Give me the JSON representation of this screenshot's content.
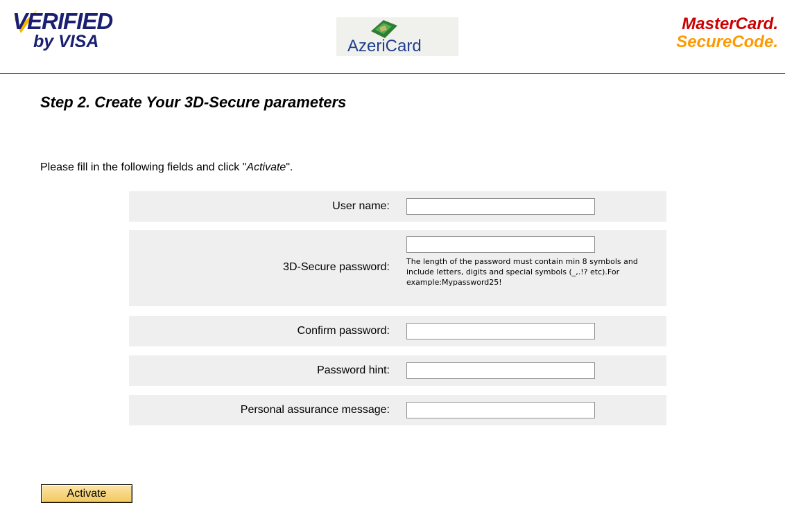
{
  "header": {
    "visa_logo": {
      "line1": "VERIFIED",
      "line2": "by VISA",
      "color": "#1a1f71"
    },
    "azeri_logo": {
      "text": "AzeriCard",
      "color": "#1f3f8f"
    },
    "mastercard_logo": {
      "line1": "MasterCard",
      "line2": "SecureCode",
      "dot": ".",
      "color_primary": "#cc0000",
      "color_secondary": "#ff9900"
    }
  },
  "page": {
    "title": "Step 2. Create Your 3D-Secure parameters",
    "instructions_prefix": "Please fill in the following fields and click \"",
    "instructions_action": "Activate",
    "instructions_suffix": "\"."
  },
  "form": {
    "fields": [
      {
        "label": "User name:",
        "value": ""
      },
      {
        "label": "3D-Secure password:",
        "value": "",
        "hint": "The length of the password must contain min 8 symbols and include letters, digits and special symbols (_,.!? etc).For example:Mypassword25!"
      },
      {
        "label": "Confirm password:",
        "value": ""
      },
      {
        "label": "Password hint:",
        "value": ""
      },
      {
        "label": "Personal assurance message:",
        "value": ""
      }
    ],
    "row_background": "#efefef"
  },
  "actions": {
    "activate_label": "Activate",
    "button_color": "#f3c75d"
  }
}
